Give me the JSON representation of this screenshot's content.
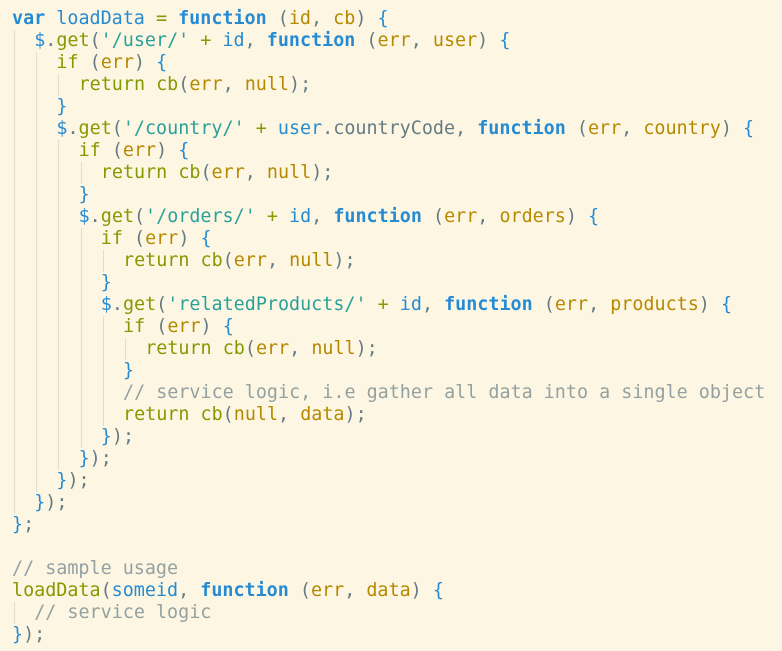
{
  "editor": {
    "language": "javascript",
    "theme": "solarized-light",
    "colors": {
      "background": "#fdf6e3",
      "keyword": "#268bd2",
      "return": "#859900",
      "identifier": "#268bd2",
      "param": "#b58900",
      "string": "#2aa198",
      "punct": "#657b83",
      "bracket": "#268bd2",
      "operator": "#859900",
      "comment": "#93a1a1",
      "null": "#b58900",
      "plain": "#657b83"
    },
    "lines": [
      {
        "indent": 0,
        "tokens": [
          {
            "t": "keyword",
            "v": "var"
          },
          {
            "t": "plain",
            "v": " "
          },
          {
            "t": "identifier",
            "v": "loadData"
          },
          {
            "t": "plain",
            "v": " "
          },
          {
            "t": "operator",
            "v": "="
          },
          {
            "t": "plain",
            "v": " "
          },
          {
            "t": "function",
            "v": "function"
          },
          {
            "t": "plain",
            "v": " "
          },
          {
            "t": "punct",
            "v": "("
          },
          {
            "t": "param",
            "v": "id"
          },
          {
            "t": "punct",
            "v": ", "
          },
          {
            "t": "param",
            "v": "cb"
          },
          {
            "t": "punct",
            "v": ")"
          },
          {
            "t": "plain",
            "v": " "
          },
          {
            "t": "bracket",
            "v": "{"
          }
        ]
      },
      {
        "indent": 1,
        "tokens": [
          {
            "t": "identifier",
            "v": "$"
          },
          {
            "t": "punct",
            "v": "."
          },
          {
            "t": "return",
            "v": "get"
          },
          {
            "t": "punct",
            "v": "("
          },
          {
            "t": "string",
            "v": "'/user/'"
          },
          {
            "t": "plain",
            "v": " "
          },
          {
            "t": "operator",
            "v": "+"
          },
          {
            "t": "plain",
            "v": " "
          },
          {
            "t": "identifier",
            "v": "id"
          },
          {
            "t": "punct",
            "v": ", "
          },
          {
            "t": "function",
            "v": "function"
          },
          {
            "t": "plain",
            "v": " "
          },
          {
            "t": "punct",
            "v": "("
          },
          {
            "t": "param",
            "v": "err"
          },
          {
            "t": "punct",
            "v": ", "
          },
          {
            "t": "param",
            "v": "user"
          },
          {
            "t": "punct",
            "v": ")"
          },
          {
            "t": "plain",
            "v": " "
          },
          {
            "t": "bracket",
            "v": "{"
          }
        ]
      },
      {
        "indent": 2,
        "tokens": [
          {
            "t": "return",
            "v": "if"
          },
          {
            "t": "plain",
            "v": " "
          },
          {
            "t": "punct",
            "v": "("
          },
          {
            "t": "param",
            "v": "err"
          },
          {
            "t": "punct",
            "v": ")"
          },
          {
            "t": "plain",
            "v": " "
          },
          {
            "t": "bracket",
            "v": "{"
          }
        ]
      },
      {
        "indent": 3,
        "tokens": [
          {
            "t": "return",
            "v": "return"
          },
          {
            "t": "plain",
            "v": " "
          },
          {
            "t": "return",
            "v": "cb"
          },
          {
            "t": "punct",
            "v": "("
          },
          {
            "t": "param",
            "v": "err"
          },
          {
            "t": "punct",
            "v": ", "
          },
          {
            "t": "null",
            "v": "null"
          },
          {
            "t": "punct",
            "v": ");"
          }
        ]
      },
      {
        "indent": 2,
        "tokens": [
          {
            "t": "bracket",
            "v": "}"
          }
        ]
      },
      {
        "indent": 2,
        "tokens": [
          {
            "t": "identifier",
            "v": "$"
          },
          {
            "t": "punct",
            "v": "."
          },
          {
            "t": "return",
            "v": "get"
          },
          {
            "t": "punct",
            "v": "("
          },
          {
            "t": "string",
            "v": "'/country/'"
          },
          {
            "t": "plain",
            "v": " "
          },
          {
            "t": "operator",
            "v": "+"
          },
          {
            "t": "plain",
            "v": " "
          },
          {
            "t": "identifier",
            "v": "user"
          },
          {
            "t": "punct",
            "v": "."
          },
          {
            "t": "plain",
            "v": "countryCode"
          },
          {
            "t": "punct",
            "v": ", "
          },
          {
            "t": "function",
            "v": "function"
          },
          {
            "t": "plain",
            "v": " "
          },
          {
            "t": "punct",
            "v": "("
          },
          {
            "t": "param",
            "v": "err"
          },
          {
            "t": "punct",
            "v": ", "
          },
          {
            "t": "param",
            "v": "country"
          },
          {
            "t": "punct",
            "v": ")"
          },
          {
            "t": "plain",
            "v": " "
          },
          {
            "t": "bracket",
            "v": "{"
          }
        ]
      },
      {
        "indent": 3,
        "tokens": [
          {
            "t": "return",
            "v": "if"
          },
          {
            "t": "plain",
            "v": " "
          },
          {
            "t": "punct",
            "v": "("
          },
          {
            "t": "param",
            "v": "err"
          },
          {
            "t": "punct",
            "v": ")"
          },
          {
            "t": "plain",
            "v": " "
          },
          {
            "t": "bracket",
            "v": "{"
          }
        ]
      },
      {
        "indent": 4,
        "tokens": [
          {
            "t": "return",
            "v": "return"
          },
          {
            "t": "plain",
            "v": " "
          },
          {
            "t": "return",
            "v": "cb"
          },
          {
            "t": "punct",
            "v": "("
          },
          {
            "t": "param",
            "v": "err"
          },
          {
            "t": "punct",
            "v": ", "
          },
          {
            "t": "null",
            "v": "null"
          },
          {
            "t": "punct",
            "v": ");"
          }
        ]
      },
      {
        "indent": 3,
        "tokens": [
          {
            "t": "bracket",
            "v": "}"
          }
        ]
      },
      {
        "indent": 3,
        "tokens": [
          {
            "t": "identifier",
            "v": "$"
          },
          {
            "t": "punct",
            "v": "."
          },
          {
            "t": "return",
            "v": "get"
          },
          {
            "t": "punct",
            "v": "("
          },
          {
            "t": "string",
            "v": "'/orders/'"
          },
          {
            "t": "plain",
            "v": " "
          },
          {
            "t": "operator",
            "v": "+"
          },
          {
            "t": "plain",
            "v": " "
          },
          {
            "t": "identifier",
            "v": "id"
          },
          {
            "t": "punct",
            "v": ", "
          },
          {
            "t": "function",
            "v": "function"
          },
          {
            "t": "plain",
            "v": " "
          },
          {
            "t": "punct",
            "v": "("
          },
          {
            "t": "param",
            "v": "err"
          },
          {
            "t": "punct",
            "v": ", "
          },
          {
            "t": "param",
            "v": "orders"
          },
          {
            "t": "punct",
            "v": ")"
          },
          {
            "t": "plain",
            "v": " "
          },
          {
            "t": "bracket",
            "v": "{"
          }
        ]
      },
      {
        "indent": 4,
        "tokens": [
          {
            "t": "return",
            "v": "if"
          },
          {
            "t": "plain",
            "v": " "
          },
          {
            "t": "punct",
            "v": "("
          },
          {
            "t": "param",
            "v": "err"
          },
          {
            "t": "punct",
            "v": ")"
          },
          {
            "t": "plain",
            "v": " "
          },
          {
            "t": "bracket",
            "v": "{"
          }
        ]
      },
      {
        "indent": 5,
        "tokens": [
          {
            "t": "return",
            "v": "return"
          },
          {
            "t": "plain",
            "v": " "
          },
          {
            "t": "return",
            "v": "cb"
          },
          {
            "t": "punct",
            "v": "("
          },
          {
            "t": "param",
            "v": "err"
          },
          {
            "t": "punct",
            "v": ", "
          },
          {
            "t": "null",
            "v": "null"
          },
          {
            "t": "punct",
            "v": ");"
          }
        ]
      },
      {
        "indent": 4,
        "tokens": [
          {
            "t": "bracket",
            "v": "}"
          }
        ]
      },
      {
        "indent": 4,
        "tokens": [
          {
            "t": "identifier",
            "v": "$"
          },
          {
            "t": "punct",
            "v": "."
          },
          {
            "t": "return",
            "v": "get"
          },
          {
            "t": "punct",
            "v": "("
          },
          {
            "t": "string",
            "v": "'relatedProducts/'"
          },
          {
            "t": "plain",
            "v": " "
          },
          {
            "t": "operator",
            "v": "+"
          },
          {
            "t": "plain",
            "v": " "
          },
          {
            "t": "identifier",
            "v": "id"
          },
          {
            "t": "punct",
            "v": ", "
          },
          {
            "t": "function",
            "v": "function"
          },
          {
            "t": "plain",
            "v": " "
          },
          {
            "t": "punct",
            "v": "("
          },
          {
            "t": "param",
            "v": "err"
          },
          {
            "t": "punct",
            "v": ", "
          },
          {
            "t": "param",
            "v": "products"
          },
          {
            "t": "punct",
            "v": ")"
          },
          {
            "t": "plain",
            "v": " "
          },
          {
            "t": "bracket",
            "v": "{"
          }
        ]
      },
      {
        "indent": 5,
        "tokens": [
          {
            "t": "return",
            "v": "if"
          },
          {
            "t": "plain",
            "v": " "
          },
          {
            "t": "punct",
            "v": "("
          },
          {
            "t": "param",
            "v": "err"
          },
          {
            "t": "punct",
            "v": ")"
          },
          {
            "t": "plain",
            "v": " "
          },
          {
            "t": "bracket",
            "v": "{"
          }
        ]
      },
      {
        "indent": 6,
        "tokens": [
          {
            "t": "return",
            "v": "return"
          },
          {
            "t": "plain",
            "v": " "
          },
          {
            "t": "return",
            "v": "cb"
          },
          {
            "t": "punct",
            "v": "("
          },
          {
            "t": "param",
            "v": "err"
          },
          {
            "t": "punct",
            "v": ", "
          },
          {
            "t": "null",
            "v": "null"
          },
          {
            "t": "punct",
            "v": ");"
          }
        ]
      },
      {
        "indent": 5,
        "tokens": [
          {
            "t": "bracket",
            "v": "}"
          }
        ]
      },
      {
        "indent": 5,
        "tokens": [
          {
            "t": "comment",
            "v": "// service logic, i.e gather all data into a single object"
          }
        ]
      },
      {
        "indent": 5,
        "tokens": [
          {
            "t": "return",
            "v": "return"
          },
          {
            "t": "plain",
            "v": " "
          },
          {
            "t": "return",
            "v": "cb"
          },
          {
            "t": "punct",
            "v": "("
          },
          {
            "t": "null",
            "v": "null"
          },
          {
            "t": "punct",
            "v": ", "
          },
          {
            "t": "param",
            "v": "data"
          },
          {
            "t": "punct",
            "v": ");"
          }
        ]
      },
      {
        "indent": 4,
        "tokens": [
          {
            "t": "bracket",
            "v": "}"
          },
          {
            "t": "punct",
            "v": ");"
          }
        ]
      },
      {
        "indent": 3,
        "tokens": [
          {
            "t": "bracket",
            "v": "}"
          },
          {
            "t": "punct",
            "v": ");"
          }
        ]
      },
      {
        "indent": 2,
        "tokens": [
          {
            "t": "bracket",
            "v": "}"
          },
          {
            "t": "punct",
            "v": ");"
          }
        ]
      },
      {
        "indent": 1,
        "tokens": [
          {
            "t": "bracket",
            "v": "}"
          },
          {
            "t": "punct",
            "v": ");"
          }
        ]
      },
      {
        "indent": 0,
        "tokens": [
          {
            "t": "bracket",
            "v": "}"
          },
          {
            "t": "punct",
            "v": ";"
          }
        ]
      },
      {
        "indent": 0,
        "tokens": []
      },
      {
        "indent": 0,
        "tokens": [
          {
            "t": "comment",
            "v": "// sample usage"
          }
        ]
      },
      {
        "indent": 0,
        "tokens": [
          {
            "t": "return",
            "v": "loadData"
          },
          {
            "t": "punct",
            "v": "("
          },
          {
            "t": "identifier",
            "v": "someid"
          },
          {
            "t": "punct",
            "v": ", "
          },
          {
            "t": "function",
            "v": "function"
          },
          {
            "t": "plain",
            "v": " "
          },
          {
            "t": "punct",
            "v": "("
          },
          {
            "t": "param",
            "v": "err"
          },
          {
            "t": "punct",
            "v": ", "
          },
          {
            "t": "param",
            "v": "data"
          },
          {
            "t": "punct",
            "v": ")"
          },
          {
            "t": "plain",
            "v": " "
          },
          {
            "t": "bracket",
            "v": "{"
          }
        ]
      },
      {
        "indent": 1,
        "tokens": [
          {
            "t": "comment",
            "v": "// service logic"
          }
        ]
      },
      {
        "indent": 0,
        "tokens": [
          {
            "t": "bracket",
            "v": "}"
          },
          {
            "t": "punct",
            "v": ");"
          }
        ]
      }
    ]
  }
}
